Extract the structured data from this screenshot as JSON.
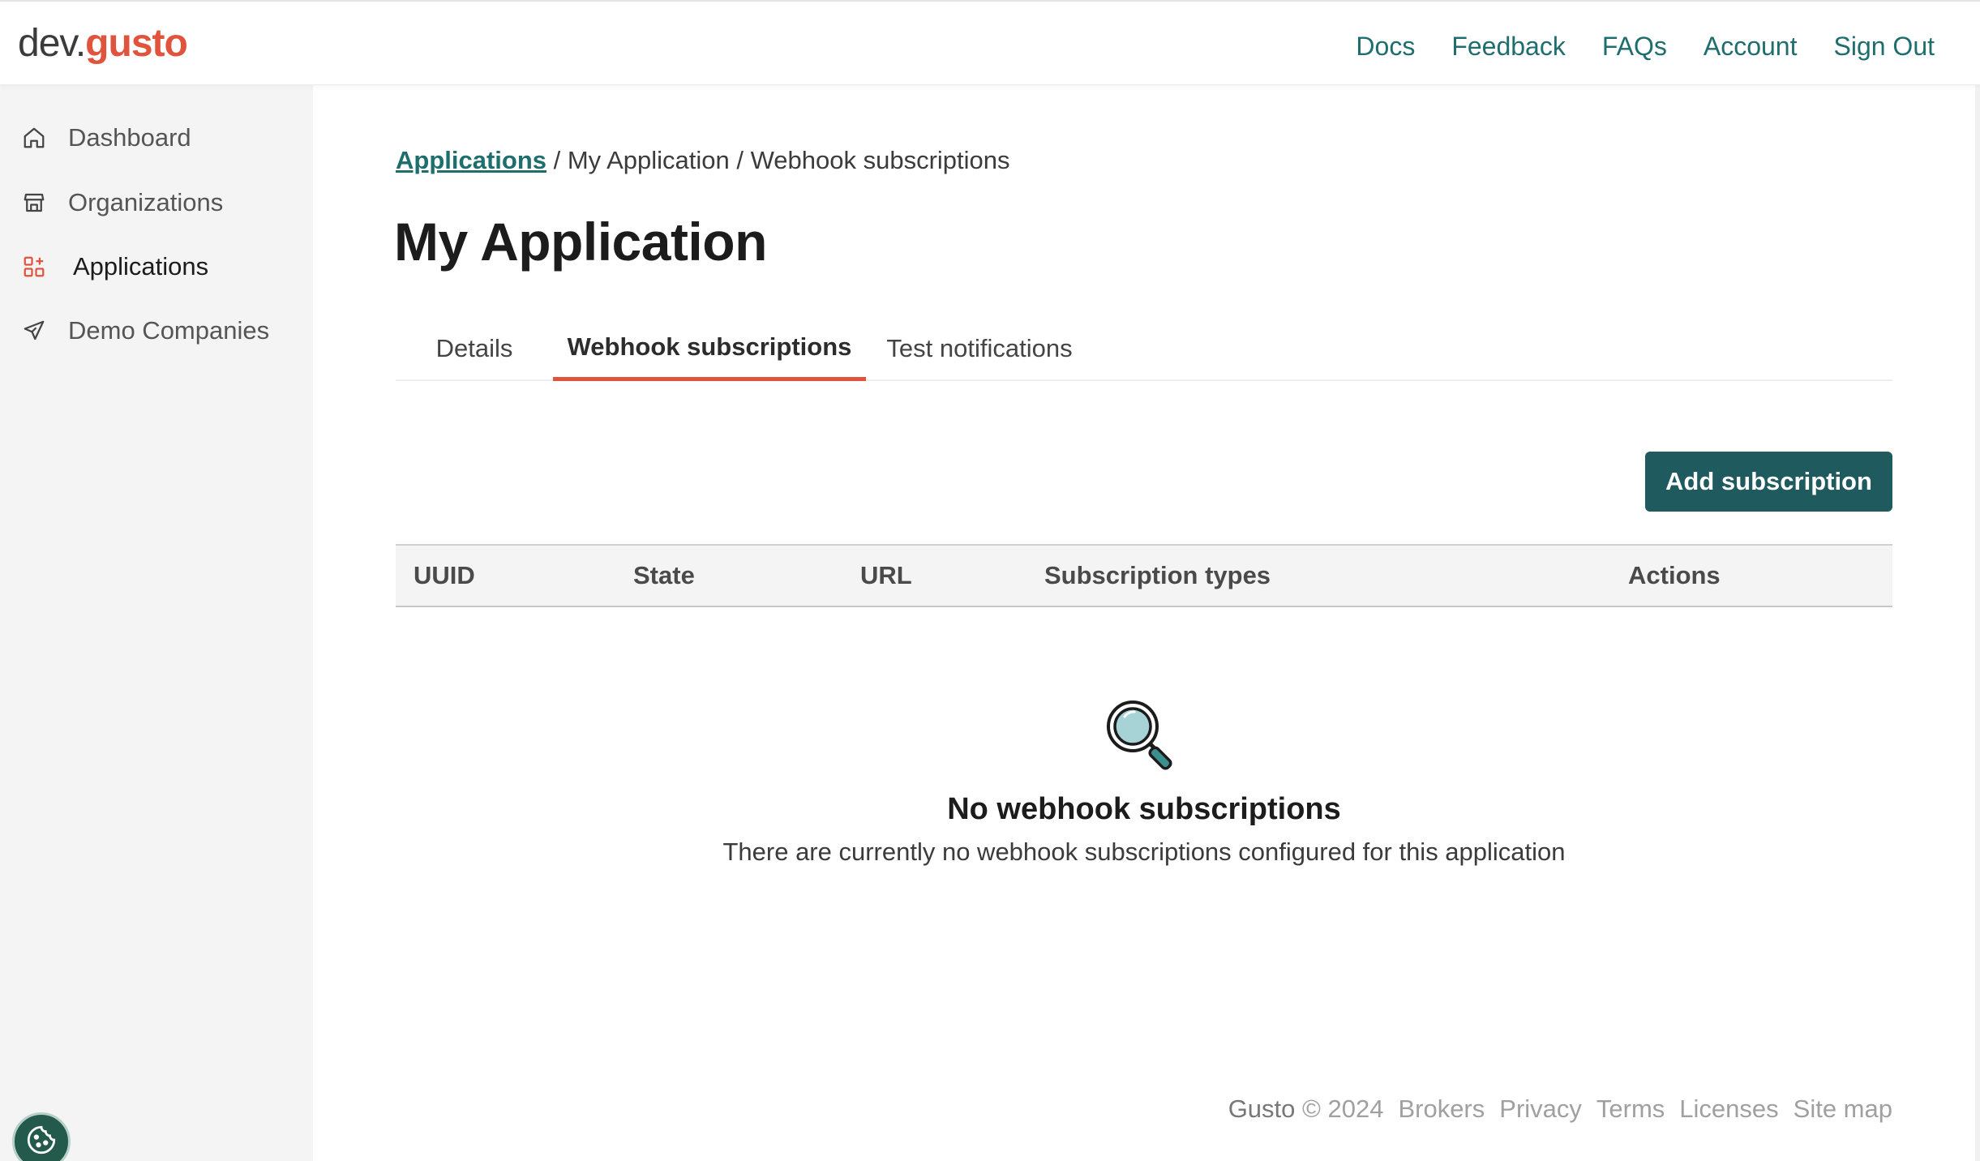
{
  "header": {
    "logo_prefix": "dev.",
    "logo_brand": "gusto",
    "nav": [
      "Docs",
      "Feedback",
      "FAQs",
      "Account",
      "Sign Out"
    ]
  },
  "sidebar": {
    "items": [
      {
        "label": "Dashboard",
        "icon": "home-icon"
      },
      {
        "label": "Organizations",
        "icon": "store-icon"
      },
      {
        "label": "Applications",
        "icon": "apps-icon",
        "active": true
      },
      {
        "label": "Demo Companies",
        "icon": "plane-icon"
      }
    ]
  },
  "breadcrumb": {
    "link": "Applications",
    "rest": " / My Application / Webhook subscriptions"
  },
  "page": {
    "title": "My Application"
  },
  "tabs": [
    {
      "label": "Details"
    },
    {
      "label": "Webhook subscriptions",
      "active": true
    },
    {
      "label": "Test notifications"
    }
  ],
  "actions": {
    "add_label": "Add subscription"
  },
  "table": {
    "columns": [
      "UUID",
      "State",
      "URL",
      "Subscription types",
      "Actions"
    ]
  },
  "empty": {
    "title": "No webhook subscriptions",
    "description": "There are currently no webhook subscriptions configured for this application"
  },
  "footer": {
    "brand": "Gusto",
    "copyright": "© 2024",
    "links": [
      "Brokers",
      "Privacy",
      "Terms",
      "Licenses",
      "Site map"
    ]
  },
  "colors": {
    "accent": "#e0533d",
    "link": "#1f6e6e",
    "primary_button": "#1f5a5e",
    "sidebar_bg": "#f4f4f4"
  }
}
